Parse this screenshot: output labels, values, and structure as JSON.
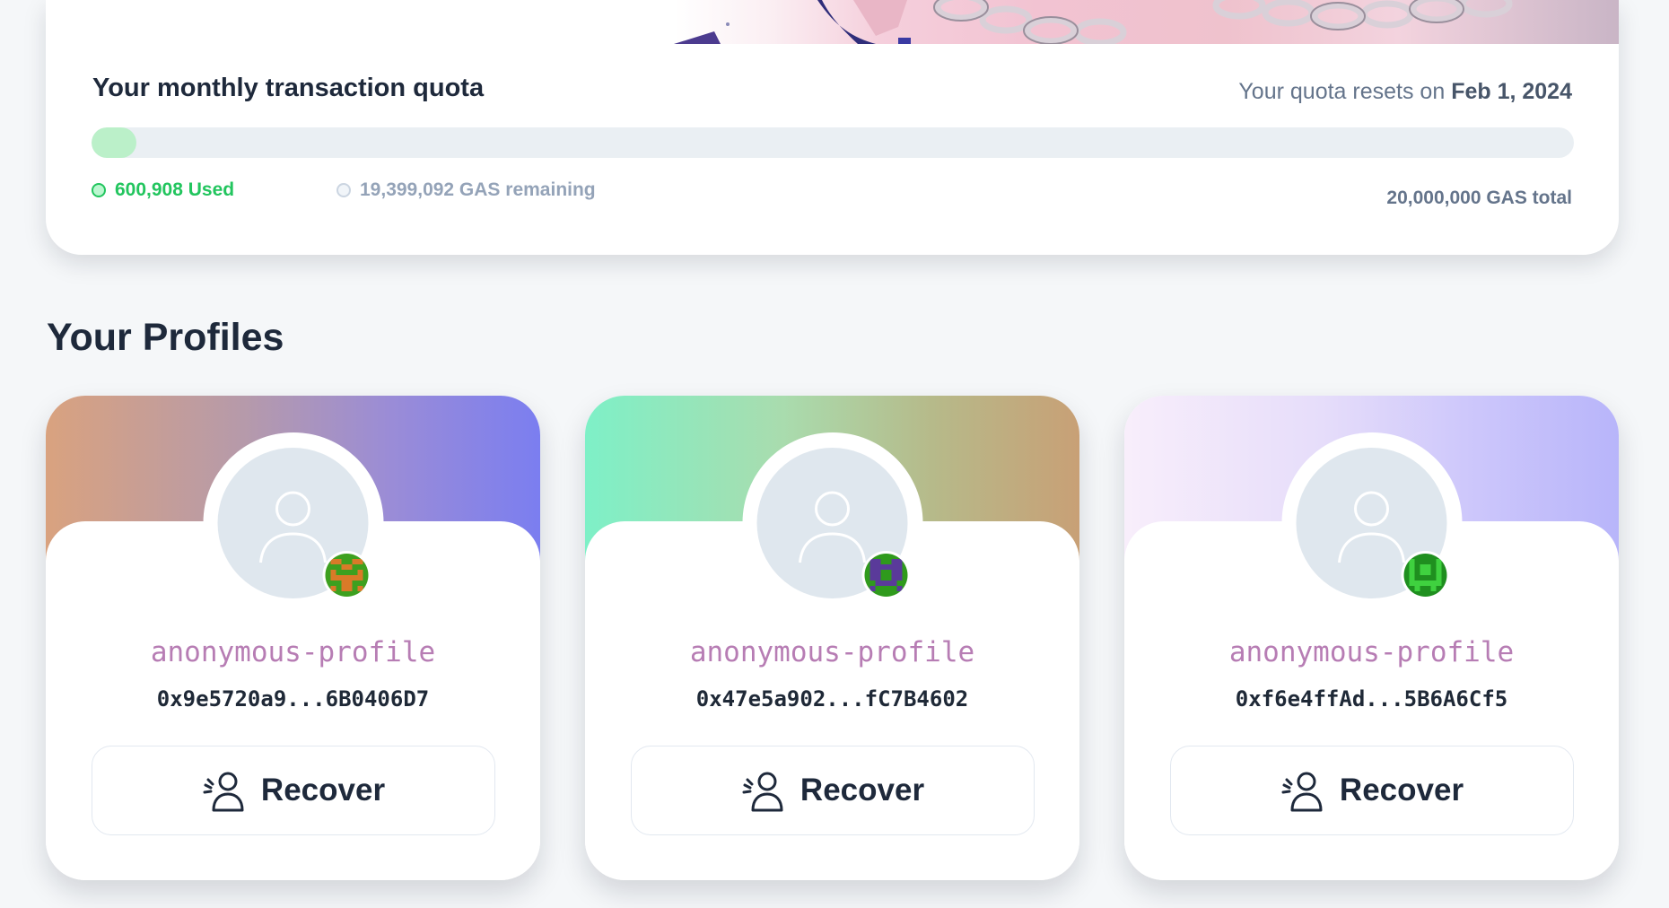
{
  "quota": {
    "title": "Your monthly transaction quota",
    "reset_prefix": "Your quota resets on",
    "reset_date": "Feb 1, 2024",
    "used_label": "600,908 Used",
    "remaining_label": "19,399,092 GAS remaining",
    "total_label": "20,000,000 GAS total",
    "used_fraction": 0.03,
    "colors": {
      "used": "#22c55e",
      "track": "#eaeff3",
      "fill": "#bbf0c9"
    }
  },
  "profiles_section": {
    "title": "Your Profiles"
  },
  "profiles": [
    {
      "name": "anonymous-profile",
      "address": "0x9e5720a9...6B0406D7",
      "button_label": "Recover",
      "avatar_icon": "user-placeholder-icon",
      "badge_icon": "identicon-orange-green"
    },
    {
      "name": "anonymous-profile",
      "address": "0x47e5a902...fC7B4602",
      "button_label": "Recover",
      "avatar_icon": "user-placeholder-icon",
      "badge_icon": "identicon-purple-green"
    },
    {
      "name": "anonymous-profile",
      "address": "0xf6e4ffAd...5B6A6Cf5",
      "button_label": "Recover",
      "avatar_icon": "user-placeholder-icon",
      "badge_icon": "identicon-green"
    }
  ]
}
